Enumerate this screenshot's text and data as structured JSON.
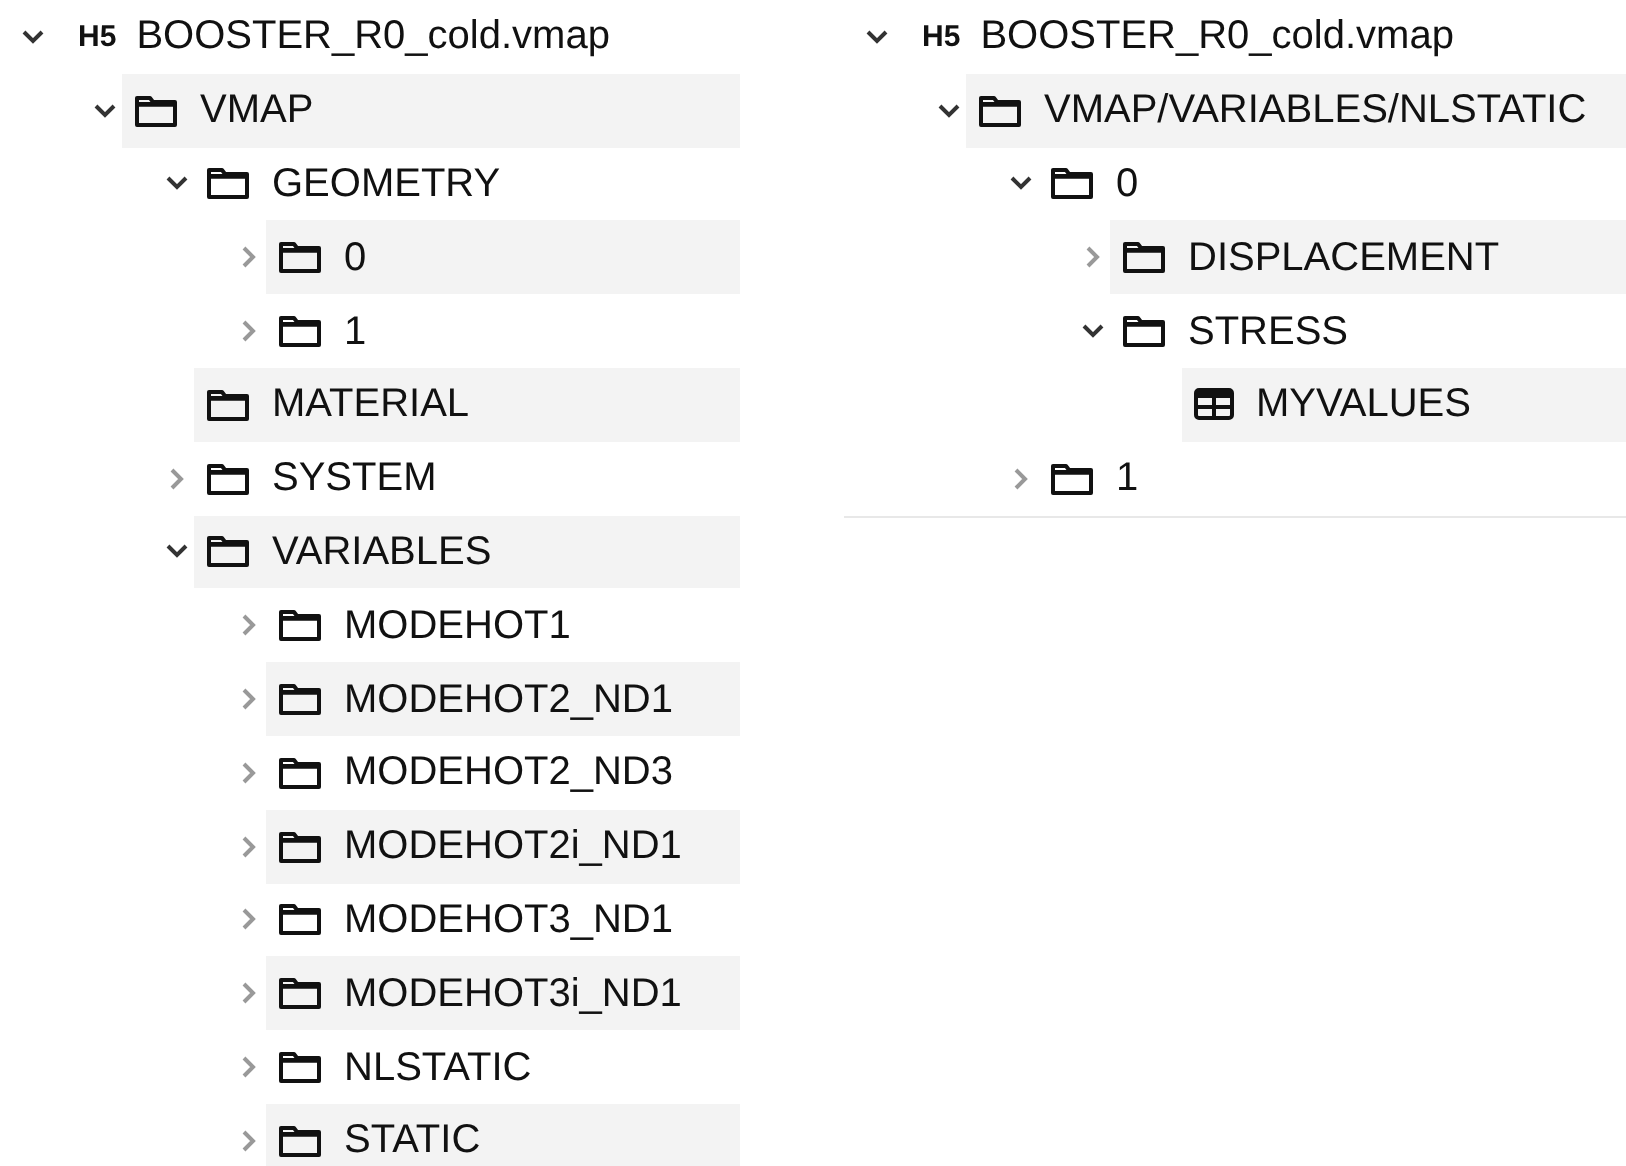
{
  "trees": [
    {
      "nodes": [
        {
          "kind": "file",
          "badge": "H5",
          "label": "BOOSTER_R0_cold.vmap",
          "expandable": true,
          "expanded": true,
          "children": [
            {
              "kind": "folder",
              "label": "VMAP",
              "expandable": true,
              "expanded": true,
              "children": [
                {
                  "kind": "folder",
                  "label": "GEOMETRY",
                  "expandable": true,
                  "expanded": true,
                  "children": [
                    {
                      "kind": "folder",
                      "label": "0",
                      "expandable": true,
                      "expanded": false
                    },
                    {
                      "kind": "folder",
                      "label": "1",
                      "expandable": true,
                      "expanded": false
                    }
                  ]
                },
                {
                  "kind": "folder",
                  "label": "MATERIAL",
                  "expandable": false
                },
                {
                  "kind": "folder",
                  "label": "SYSTEM",
                  "expandable": true,
                  "expanded": false
                },
                {
                  "kind": "folder",
                  "label": "VARIABLES",
                  "expandable": true,
                  "expanded": true,
                  "children": [
                    {
                      "kind": "folder",
                      "label": "MODEHOT1",
                      "expandable": true,
                      "expanded": false
                    },
                    {
                      "kind": "folder",
                      "label": "MODEHOT2_ND1",
                      "expandable": true,
                      "expanded": false
                    },
                    {
                      "kind": "folder",
                      "label": "MODEHOT2_ND3",
                      "expandable": true,
                      "expanded": false
                    },
                    {
                      "kind": "folder",
                      "label": "MODEHOT2i_ND1",
                      "expandable": true,
                      "expanded": false
                    },
                    {
                      "kind": "folder",
                      "label": "MODEHOT3_ND1",
                      "expandable": true,
                      "expanded": false
                    },
                    {
                      "kind": "folder",
                      "label": "MODEHOT3i_ND1",
                      "expandable": true,
                      "expanded": false
                    },
                    {
                      "kind": "folder",
                      "label": "NLSTATIC",
                      "expandable": true,
                      "expanded": false
                    },
                    {
                      "kind": "folder",
                      "label": "STATIC",
                      "expandable": true,
                      "expanded": false
                    }
                  ]
                }
              ]
            }
          ]
        }
      ]
    },
    {
      "nodes": [
        {
          "kind": "file",
          "badge": "H5",
          "label": "BOOSTER_R0_cold.vmap",
          "expandable": true,
          "expanded": true,
          "children": [
            {
              "kind": "folder",
              "label": "VMAP/VARIABLES/NLSTATIC",
              "expandable": true,
              "expanded": true,
              "children": [
                {
                  "kind": "folder",
                  "label": "0",
                  "expandable": true,
                  "expanded": true,
                  "children": [
                    {
                      "kind": "folder",
                      "label": "DISPLACEMENT",
                      "expandable": true,
                      "expanded": false
                    },
                    {
                      "kind": "folder",
                      "label": "STRESS",
                      "expandable": true,
                      "expanded": true,
                      "children": [
                        {
                          "kind": "dataset",
                          "label": "MYVALUES",
                          "expandable": false
                        }
                      ]
                    }
                  ]
                },
                {
                  "kind": "folder",
                  "label": "1",
                  "expandable": true,
                  "expanded": false
                }
              ]
            }
          ]
        }
      ]
    }
  ]
}
